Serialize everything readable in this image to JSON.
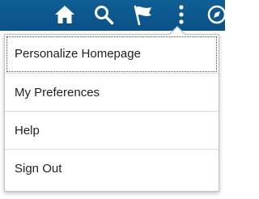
{
  "toolbar": {
    "icons": [
      "home-icon",
      "search-icon",
      "flag-icon",
      "more-vertical-icon",
      "navbar-compass-icon"
    ],
    "background": "#0c5a8e"
  },
  "menu": {
    "items": [
      {
        "label": "Personalize Homepage"
      },
      {
        "label": "My Preferences"
      },
      {
        "label": "Help"
      },
      {
        "label": "Sign Out"
      }
    ]
  }
}
